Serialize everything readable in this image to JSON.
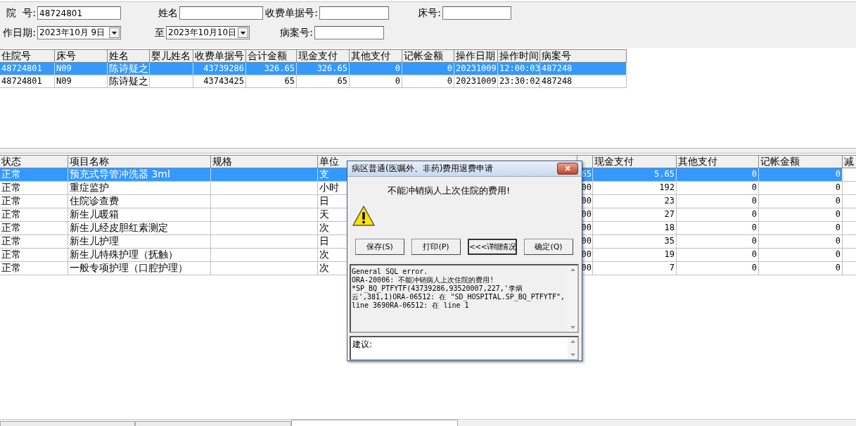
{
  "filter_form": {
    "rows": [
      [
        {
          "label": "院  号:",
          "value": "48724801",
          "kind": "text"
        },
        {
          "label": "姓名",
          "kind": "text"
        },
        {
          "label": "收费单据号:",
          "kind": "text"
        },
        {
          "label": "床号:",
          "kind": "text"
        }
      ],
      [
        {
          "label": "作日期:",
          "value": "2023年10月 9日",
          "kind": "date"
        },
        {
          "label": "至",
          "value": "2023年10月10日",
          "kind": "date"
        },
        {
          "label": "病案号:",
          "kind": "text"
        }
      ]
    ]
  },
  "records_table": {
    "columns": [
      "住院号",
      "床号",
      "姓名",
      "婴儿姓名",
      "收费单据号",
      "合计金额",
      "现金支付",
      "其他支付",
      "记帐金额",
      "操作日期",
      "操作时间",
      "病案号"
    ],
    "rows": [
      {
        "selected": true,
        "cells": [
          "48724801",
          "N09",
          "陈诗疑之",
          "",
          "43739286",
          "326.65",
          "326.65",
          "0",
          "0",
          "20231009",
          "12:00:03",
          "487248"
        ]
      },
      {
        "selected": false,
        "cells": [
          "48724801",
          "N09",
          "陈诗疑之",
          "",
          "43743425",
          "65",
          "65",
          "0",
          "0",
          "20231009",
          "23:30:02",
          "487248"
        ]
      }
    ]
  },
  "items_table": {
    "columns": [
      "状态",
      "项目名称",
      "规格",
      "单位",
      "",
      "现金支付",
      "其他支付",
      "记帐金额",
      "减"
    ],
    "rows": [
      {
        "selected": true,
        "cells": [
          "正常",
          "预充式导管冲洗器 3ml",
          "",
          "支",
          "65",
          "5.65",
          "0",
          "0",
          ""
        ]
      },
      {
        "selected": false,
        "cells": [
          "正常",
          "重症监护",
          "",
          "小时",
          "00",
          "192",
          "0",
          "0",
          ""
        ]
      },
      {
        "selected": false,
        "cells": [
          "正常",
          "住院诊查费",
          "",
          "日",
          "00",
          "23",
          "0",
          "0",
          ""
        ]
      },
      {
        "selected": false,
        "cells": [
          "正常",
          "新生儿暖箱",
          "",
          "天",
          "00",
          "27",
          "0",
          "0",
          ""
        ]
      },
      {
        "selected": false,
        "cells": [
          "正常",
          "新生儿经皮胆红素测定",
          "",
          "次",
          "00",
          "18",
          "0",
          "0",
          ""
        ]
      },
      {
        "selected": false,
        "cells": [
          "正常",
          "新生儿护理",
          "",
          "日",
          "00",
          "35",
          "0",
          "0",
          ""
        ]
      },
      {
        "selected": false,
        "cells": [
          "正常",
          "新生儿特殊护理（抚触）",
          "",
          "次",
          "00",
          "19",
          "0",
          "0",
          ""
        ]
      },
      {
        "selected": false,
        "cells": [
          "正常",
          "一般专项护理（口腔护理）",
          "",
          "次",
          "00",
          "7",
          "0",
          "0",
          ""
        ]
      }
    ]
  },
  "dialog": {
    "title": "病区普通(医嘱外、非药)费用退费申请",
    "close": "×",
    "message": "不能冲销病人上次住院的费用!",
    "buttons": [
      {
        "label": "保存(S)",
        "focused": false
      },
      {
        "label": "打印(P)",
        "focused": false
      },
      {
        "label": "<<<详细情况",
        "focused": true
      },
      {
        "label": "确定(Q)",
        "focused": false
      }
    ],
    "details": "General SQL error.\nORA-20006: 不能冲销病人上次住院的费用!\n*SP_BQ_PTFYTF(43739286,93520007,227,'李炳云',381,1)ORA-06512: 在 \"SD_HOSPITAL.SP_BQ_PTFYTF\", line 3690RA-06512: 在 line 1",
    "suggestion_label": "建议:"
  },
  "bottom_tabs": [
    {
      "selected": false
    },
    {
      "selected": false
    },
    {
      "selected": true
    }
  ]
}
